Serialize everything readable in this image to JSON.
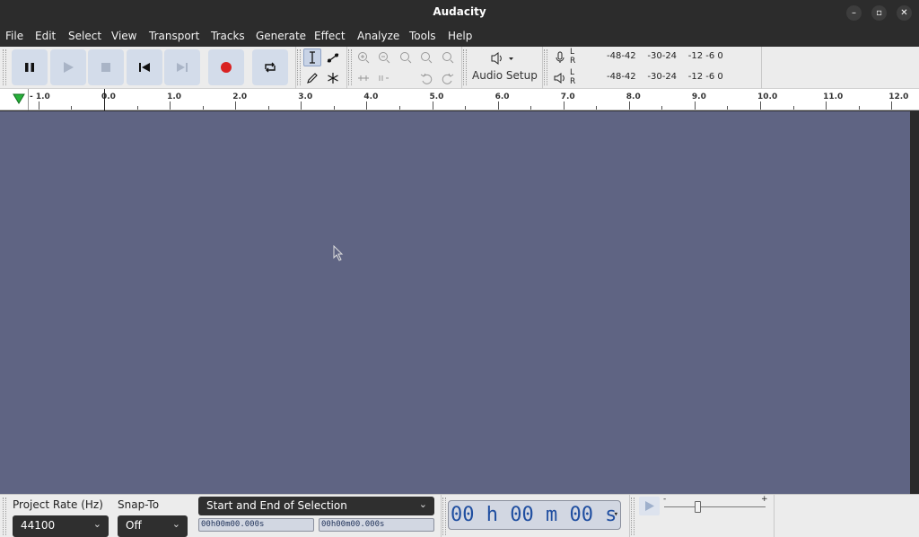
{
  "window": {
    "title": "Audacity"
  },
  "menu": [
    "File",
    "Edit",
    "Select",
    "View",
    "Transport",
    "Tracks",
    "Generate",
    "Effect",
    "Analyze",
    "Tools",
    "Help"
  ],
  "transport": {
    "buttons": [
      "pause-icon",
      "play-icon",
      "stop-icon",
      "skip-to-start-icon",
      "skip-to-end-icon",
      "record-icon",
      "loop-icon"
    ],
    "record_color": "#d92222"
  },
  "audio_setup": {
    "label": "Audio Setup"
  },
  "meters": {
    "record_scale": "-48-42    -30-24    -12 -6 0",
    "playback_scale": "-48-42    -30-24    -12 -6 0",
    "lr_top": "L",
    "lr_bottom": "R"
  },
  "ruler": {
    "labels": [
      "- 1.0",
      "0.0",
      "1.0",
      "2.0",
      "3.0",
      "4.0",
      "5.0",
      "6.0",
      "7.0",
      "8.0",
      "9.0",
      "10.0",
      "11.0",
      "12.0"
    ]
  },
  "colors": {
    "track_bg": "#5f6483",
    "accent": "#1f4ea0",
    "toolbar_bg": "#ececec"
  },
  "selection_toolbar": {
    "project_rate_label": "Project Rate (Hz)",
    "project_rate_value": "44100",
    "snap_to_label": "Snap-To",
    "snap_to_value": "Off",
    "selection_mode": "Start and End of Selection",
    "start_time": "00h00m00.000s",
    "end_time": "00h00m00.000s",
    "audio_position": "00 h 00 m 00 s"
  },
  "play_at_speed": {
    "min_label": "-",
    "max_label": "+"
  }
}
